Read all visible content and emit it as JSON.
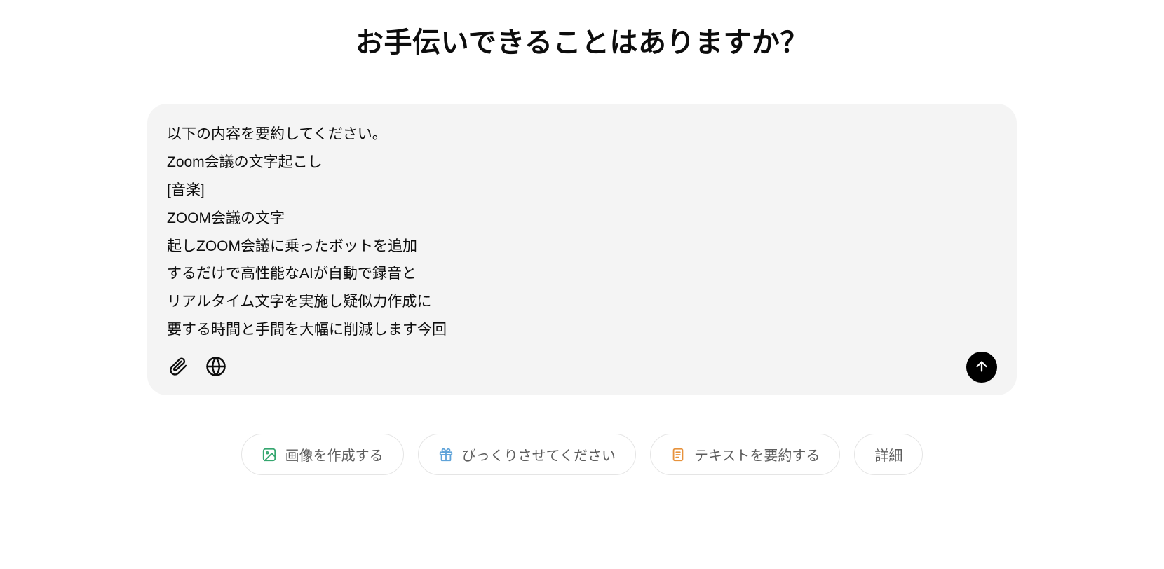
{
  "header": {
    "title": "お手伝いできることはありますか？"
  },
  "composer": {
    "text": "以下の内容を要約してください。\nZoom会議の文字起こし\n[音楽]\nZOOM会議の文字\n起しZOOM会議に乗ったボットを追加\nするだけで高性能なAIが自動で録音と\nリアルタイム文字を実施し疑似力作成に\n要する時間と手間を大幅に削減します今回",
    "attach_icon": "paperclip-icon",
    "web_icon": "globe-icon",
    "send_icon": "arrow-up-icon"
  },
  "suggestions": [
    {
      "icon": "image-icon",
      "icon_color": "#35a66f",
      "label": "画像を作成する"
    },
    {
      "icon": "gift-icon",
      "icon_color": "#5fa3d9",
      "label": "びっくりさせてください"
    },
    {
      "icon": "document-icon",
      "icon_color": "#e7923c",
      "label": "テキストを要約する"
    },
    {
      "icon": "",
      "icon_color": "",
      "label": "詳細"
    }
  ]
}
